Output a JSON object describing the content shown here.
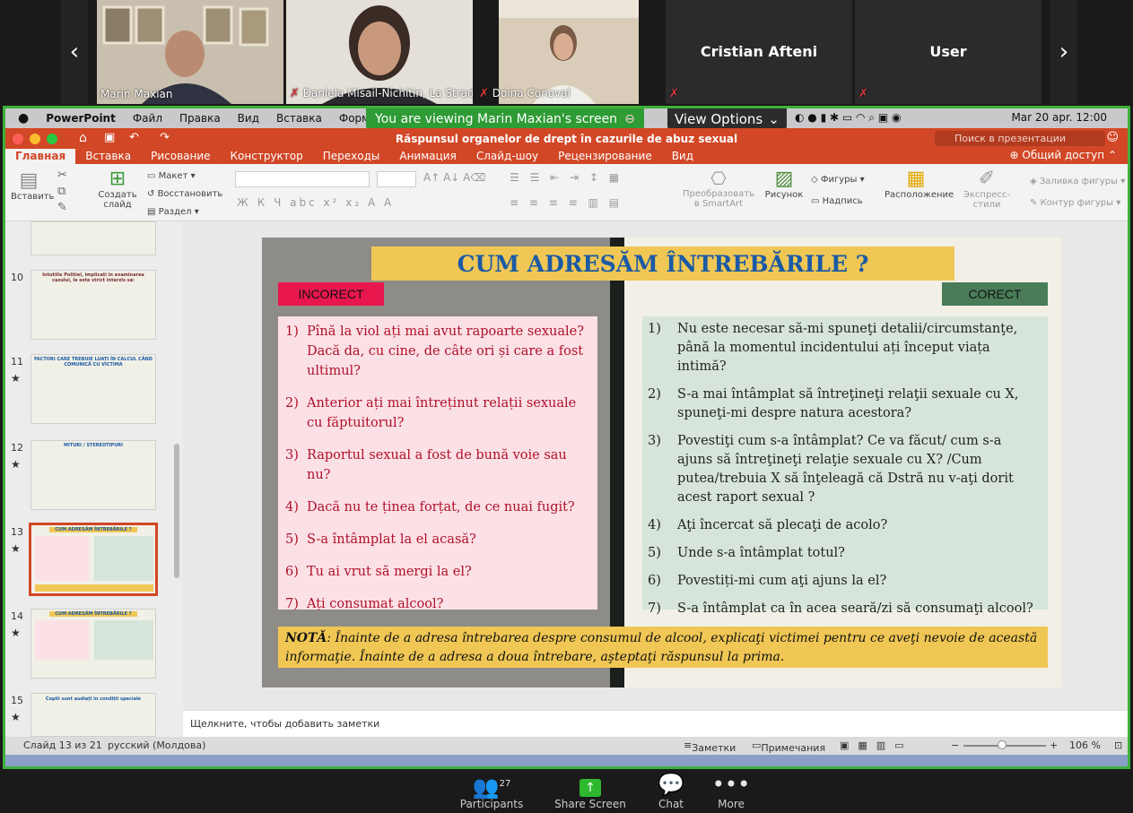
{
  "participants_strip": {
    "tiles": [
      {
        "name": "Marin Maxian",
        "muted": false
      },
      {
        "name": "Daniela Misail-Nichitin, La Strad...",
        "muted": true
      },
      {
        "name": "Doina Conoval",
        "muted": true
      },
      {
        "name": "Cristian Afteni",
        "muted": true
      },
      {
        "name": "User",
        "muted": true
      }
    ],
    "prev_arrow": "‹",
    "next_arrow": "›"
  },
  "share_banner": {
    "viewing": "You are viewing Marin Maxian's screen",
    "view_options": "View Options"
  },
  "mac_menu": {
    "app": "PowerPoint",
    "items": [
      "Файл",
      "Правка",
      "Вид",
      "Вставка",
      "Формат"
    ],
    "clock": "Mar 20 apr. 12:00"
  },
  "powerpoint": {
    "doc_title": "Răspunsul organelor de drept în cazurile de abuz sexual",
    "search_placeholder": "Поиск в презентации",
    "share_label": "Общий доступ",
    "tabs": [
      "Главная",
      "Вставка",
      "Рисование",
      "Конструктор",
      "Переходы",
      "Анимация",
      "Слайд-шоу",
      "Рецензирование",
      "Вид"
    ],
    "active_tab": "Главная",
    "ribbon": {
      "paste": "Вставить",
      "new_slide": "Создать слайд",
      "layout": "Макет",
      "reset": "Восстановить",
      "section": "Раздел",
      "smartart": "Преобразовать в SmartArt",
      "picture": "Рисунок",
      "shapes": "Фигуры",
      "textbox": "Надпись",
      "arrange": "Расположение",
      "quick_styles": "Экспресс-стили",
      "shape_fill": "Заливка фигуры",
      "shape_outline": "Контур фигуры"
    },
    "thumbnails": [
      {
        "num": "10",
        "star": false,
        "title": "Intutiile Poliției, implicați în examinarea cazului, le este strict interzis să:"
      },
      {
        "num": "11",
        "star": true,
        "title": "FACTORI CARE TREBUIE LUAȚI ÎN CALCUL CÂND COMUNICĂ CU VICTIMA"
      },
      {
        "num": "12",
        "star": true,
        "title": "MITURI / STEREOTIPURI"
      },
      {
        "num": "13",
        "star": true,
        "title": "CUM ADRESĂM ÎNTREBĂRILE ?",
        "selected": true
      },
      {
        "num": "14",
        "star": true,
        "title": "CUM ADRESĂM ÎNTREBĂRILE ?"
      },
      {
        "num": "15",
        "star": true,
        "title": "Copiii sunt audiați în condiții speciale"
      }
    ],
    "slide": {
      "title": "CUM ADRESĂM ÎNTREBĂRILE ?",
      "incorrect_label": "INCORECT",
      "correct_label": "CORECT",
      "incorrect": [
        {
          "n": "1)",
          "text": "Pînă la viol ați mai avut rapoarte sexuale? Dacă da, cu cine, de câte ori și care a fost ultimul?"
        },
        {
          "n": "2)",
          "text": "Anterior ați mai întreținut relații sexuale cu făptuitorul?"
        },
        {
          "n": "3)",
          "text": "Raportul sexual a fost de bună voie sau nu?"
        },
        {
          "n": "4)",
          "text": "Dacă nu te ținea forțat, de ce nuai fugit?"
        },
        {
          "n": "5)",
          "text": "S-a întâmplat la el acasă?"
        },
        {
          "n": "6)",
          "text": "Tu ai vrut să mergi la el?"
        },
        {
          "n": "7)",
          "text": "Ați consumat alcool?"
        }
      ],
      "correct": [
        {
          "n": "1)",
          "text": "Nu este necesar să-mi spuneţi detalii/circumstanţe, până la momentul incidentului ați început viața intimă?"
        },
        {
          "n": "2)",
          "text": "S-a mai întâmplat să întreţineţi relaţii sexuale cu X, spuneţi-mi despre natura acestora?"
        },
        {
          "n": "3)",
          "text": "Povestiţi cum s-a întâmplat?  Ce va făcut/ cum s-a ajuns să întreţineţi relaţie sexuale cu X? /Cum putea/trebuia X să înţeleagă că Dstră nu v-aţi dorit acest raport sexual ?"
        },
        {
          "n": "4)",
          "text": "Aţi încercat să plecaţi de acolo?"
        },
        {
          "n": "5)",
          "text": "Unde s-a întâmplat totul?"
        },
        {
          "n": "6)",
          "text": "Povestiți-mi cum aţi ajuns la el?"
        },
        {
          "n": "7)",
          "text": "S-a întâmplat ca în acea seară/zi să consumaţi alcool?"
        }
      ],
      "note_label": "NOTĂ",
      "note_text": ": Înainte de a adresa întrebarea despre consumul de alcool, explicaţi victimei pentru ce aveţi nevoie de această informaţie. Înainte de a adresa a doua întrebare, aşteptaţi  răspunsul la prima."
    },
    "notes_placeholder": "Щелкните, чтобы добавить заметки",
    "status": {
      "slide_of": "Слайд 13 из 21",
      "language": "русский (Молдова)",
      "notes_btn": "Заметки",
      "comments_btn": "Примечания",
      "zoom": "106 %"
    }
  },
  "zoom_toolbar": {
    "participants_label": "Participants",
    "participants_count": "27",
    "share_label": "Share Screen",
    "chat_label": "Chat",
    "more_label": "More"
  },
  "colors": {
    "ppt_accent": "#d24726",
    "share_green": "#2e9b35",
    "slide_title_blue": "#1b5aa5"
  }
}
